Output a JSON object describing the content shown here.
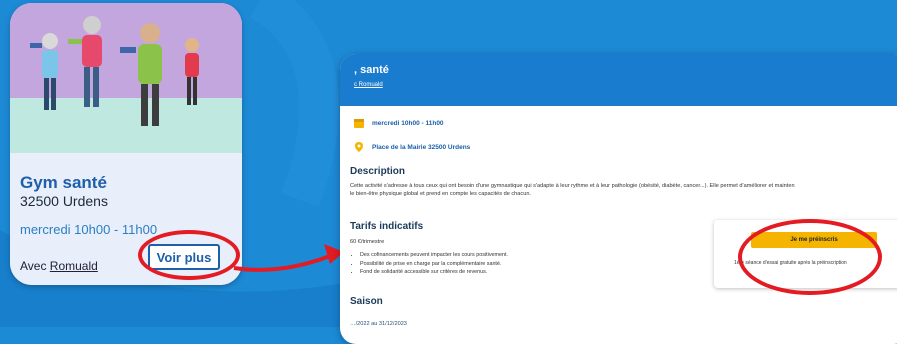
{
  "card": {
    "title": "Gym santé",
    "city": "32500 Urdens",
    "time": "mercredi 10h00 - 11h00",
    "coach_prefix": "Avec ",
    "coach_name": "Romuald",
    "button": "Voir plus"
  },
  "page": {
    "header_title": ", santé",
    "header_coach": "c Romuald",
    "info_time": "mercredi 10h00 - 11h00",
    "info_place": "Place de la Mairie 32500 Urdens",
    "description_title": "Description",
    "description_text": "Cette activité s'adresse à tous ceux qui ont besoin d'une gymnastique qui s'adapte à leur rythme et à leur pathologie (obésité, diabète, cancer...). Elle permet d'améliorer et mainten",
    "description_text2": "le bien-être physique global et prend en compte les capacités de chacun.",
    "tarifs_title": "Tarifs indicatifs",
    "tarifs_price": "60 €/trimestre",
    "tarifs_items": [
      "Des cofinancements peuvent impacter les cours positivement.",
      "Possibilité de prise en charge par la complémentaire santé.",
      "Fond de solidarité accessible sur critères de revenus."
    ],
    "saison_title": "Saison",
    "saison_dates": "…/2022 au 31/12/2023",
    "signup_button": "Je me préinscris",
    "signup_note": "1ère séance d'essai gratuite après la préinscription"
  },
  "colors": {
    "brand_blue": "#1a7ccf",
    "accent_yellow": "#f4b400",
    "highlight_red": "#e31b23"
  }
}
